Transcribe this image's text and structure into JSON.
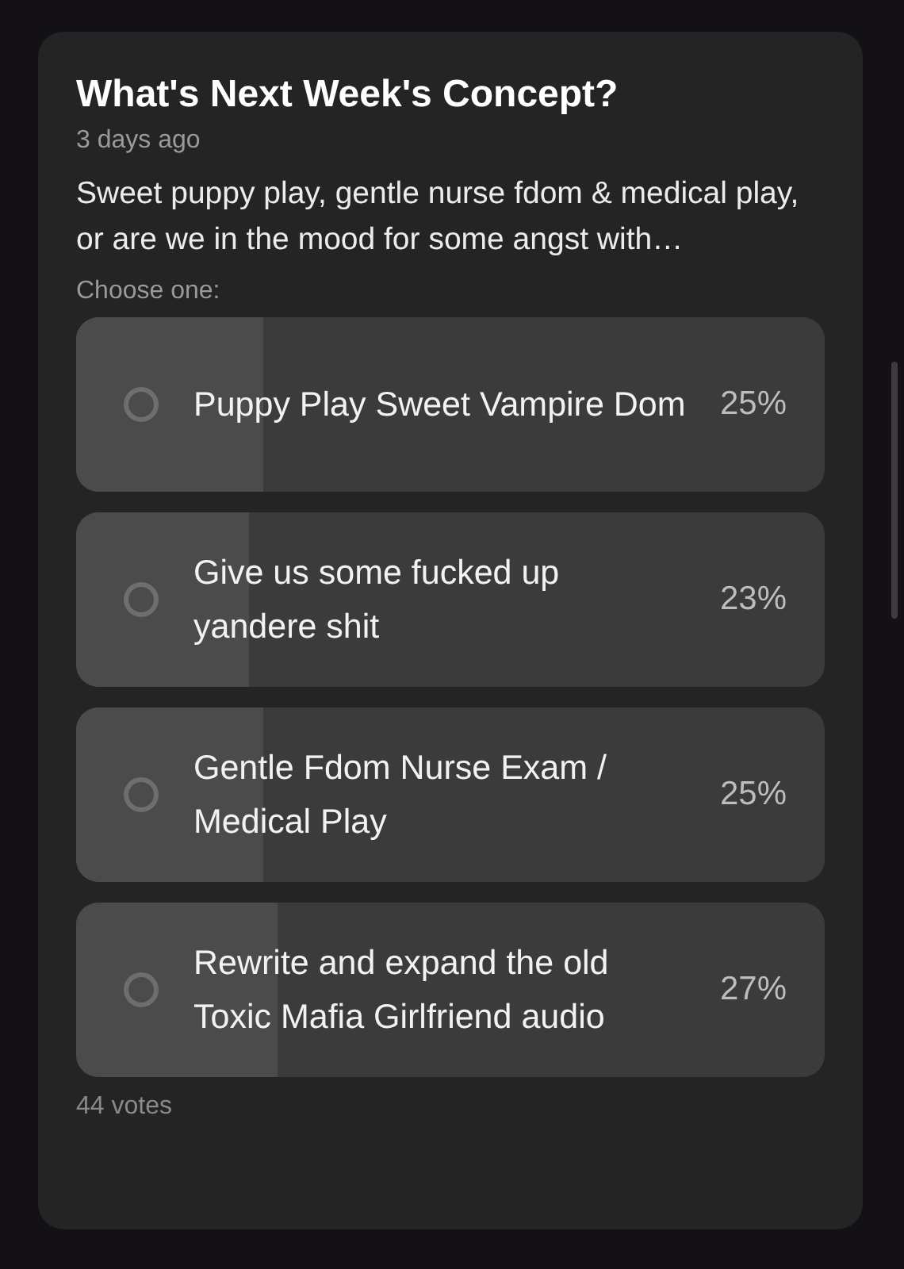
{
  "poll": {
    "title": "What's Next Week's Concept?",
    "time": "3 days ago",
    "description": "Sweet puppy play, gentle nurse fdom & medical play, or are we in the mood for some angst with…",
    "prompt": "Choose one:",
    "options": [
      {
        "label": "Puppy Play Sweet Vampire Dom",
        "percent": "25%",
        "level": 0.25,
        "selected": false
      },
      {
        "label": "Give us some fucked up yandere shit",
        "percent": "23%",
        "level": 0.23,
        "selected": false
      },
      {
        "label": "Gentle Fdom Nurse Exam / Medical Play",
        "percent": "25%",
        "level": 0.25,
        "selected": false
      },
      {
        "label": "Rewrite and expand the old Toxic Mafia Girlfriend audio",
        "percent": "27%",
        "level": 0.27,
        "selected": false
      }
    ],
    "votes": "44 votes"
  }
}
